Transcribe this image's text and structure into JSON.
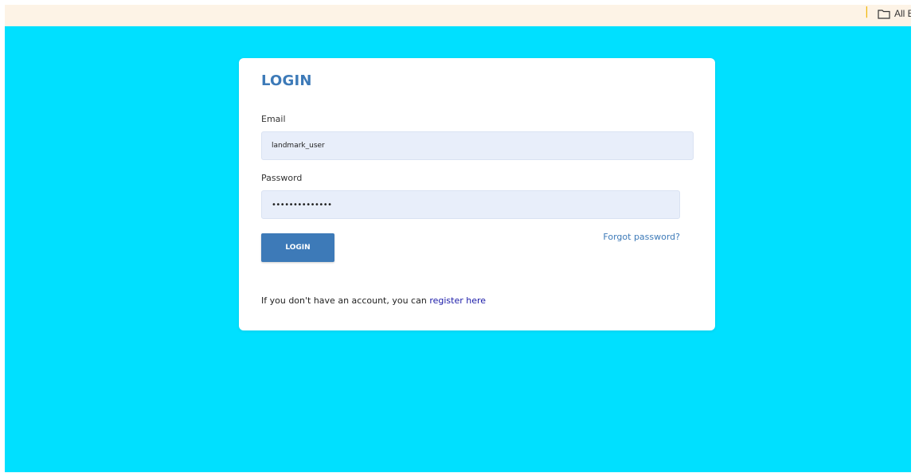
{
  "browser": {
    "bookmarks_bar": {
      "divider": "|",
      "all_bookmarks_label": "All B"
    }
  },
  "login": {
    "title": "LOGIN",
    "email_label": "Email",
    "email_value": "landmark_user",
    "password_label": "Password",
    "password_value": "••••••••••••••",
    "login_button_label": "LOGIN",
    "forgot_password_label": "Forgot password?",
    "register_prompt": "If you don't have an account, you can ",
    "register_link_label": "register here"
  },
  "colors": {
    "page_background": "#00e0ff",
    "accent": "#3d7ab8",
    "input_background": "#e8eefa",
    "card_background": "#ffffff",
    "link": "#1a1aa8"
  }
}
